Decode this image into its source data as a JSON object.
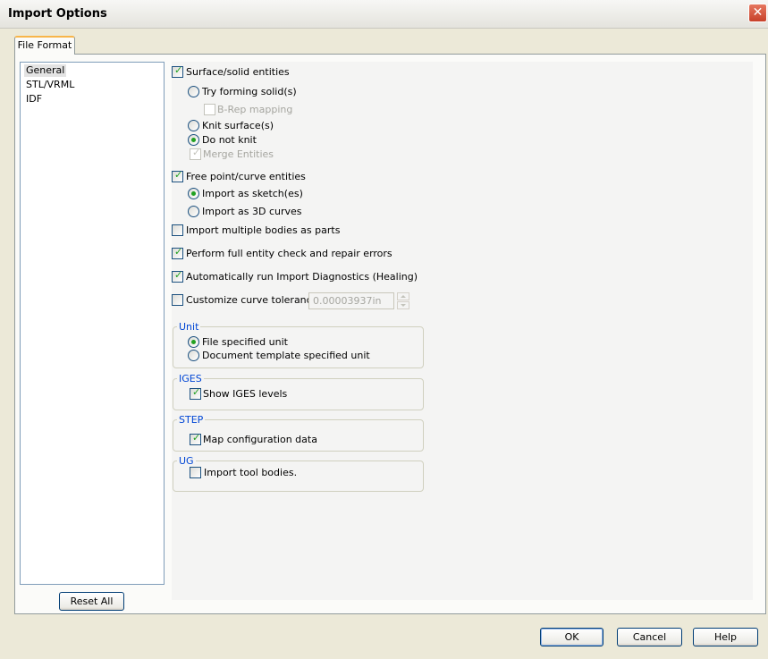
{
  "window": {
    "title": "Import Options",
    "close_glyph": "✕"
  },
  "tabs": [
    {
      "label": "File Format"
    }
  ],
  "categories": [
    {
      "label": "General",
      "selected": true
    },
    {
      "label": "STL/VRML",
      "selected": false
    },
    {
      "label": "IDF",
      "selected": false
    }
  ],
  "options": {
    "surface_solid": {
      "label": "Surface/solid entities",
      "checked": true
    },
    "try_forming_solids": {
      "label": "Try forming solid(s)",
      "selected": false
    },
    "brep_mapping": {
      "label": "B-Rep mapping",
      "checked": false,
      "enabled": false
    },
    "knit_surfaces": {
      "label": "Knit surface(s)",
      "selected": false
    },
    "do_not_knit": {
      "label": "Do not knit",
      "selected": true
    },
    "merge_entities": {
      "label": "Merge Entities",
      "checked": true,
      "enabled": false
    },
    "free_point_curve": {
      "label": "Free point/curve entities",
      "checked": true
    },
    "import_as_sketches": {
      "label": "Import as sketch(es)",
      "selected": true
    },
    "import_as_3d_curves": {
      "label": "Import as 3D curves",
      "selected": false
    },
    "import_multiple_bodies": {
      "label": "Import multiple bodies as parts",
      "checked": false
    },
    "full_entity_check": {
      "label": "Perform full entity check and repair errors",
      "checked": true
    },
    "auto_diagnostics": {
      "label": "Automatically run Import Diagnostics (Healing)",
      "checked": true
    },
    "customize_tolerance": {
      "label": "Customize curve tolerance:",
      "checked": false,
      "value": "0.00003937in"
    }
  },
  "unit_group": {
    "title": "Unit",
    "file_specified": {
      "label": "File specified unit",
      "selected": true
    },
    "document_template": {
      "label": "Document template specified unit",
      "selected": false
    }
  },
  "iges_group": {
    "title": "IGES",
    "show_levels": {
      "label": "Show IGES levels",
      "checked": true
    }
  },
  "step_group": {
    "title": "STEP",
    "map_config": {
      "label": "Map configuration data",
      "checked": true
    }
  },
  "ug_group": {
    "title": "UG",
    "import_tool_bodies": {
      "label": "Import tool bodies.",
      "checked": false
    }
  },
  "buttons": {
    "reset_all": "Reset All",
    "ok": "OK",
    "cancel": "Cancel",
    "help": "Help"
  },
  "colors": {
    "checkmark": "#21a121",
    "group_title": "#0046d5",
    "tab_highlight": "#f8b54a"
  }
}
